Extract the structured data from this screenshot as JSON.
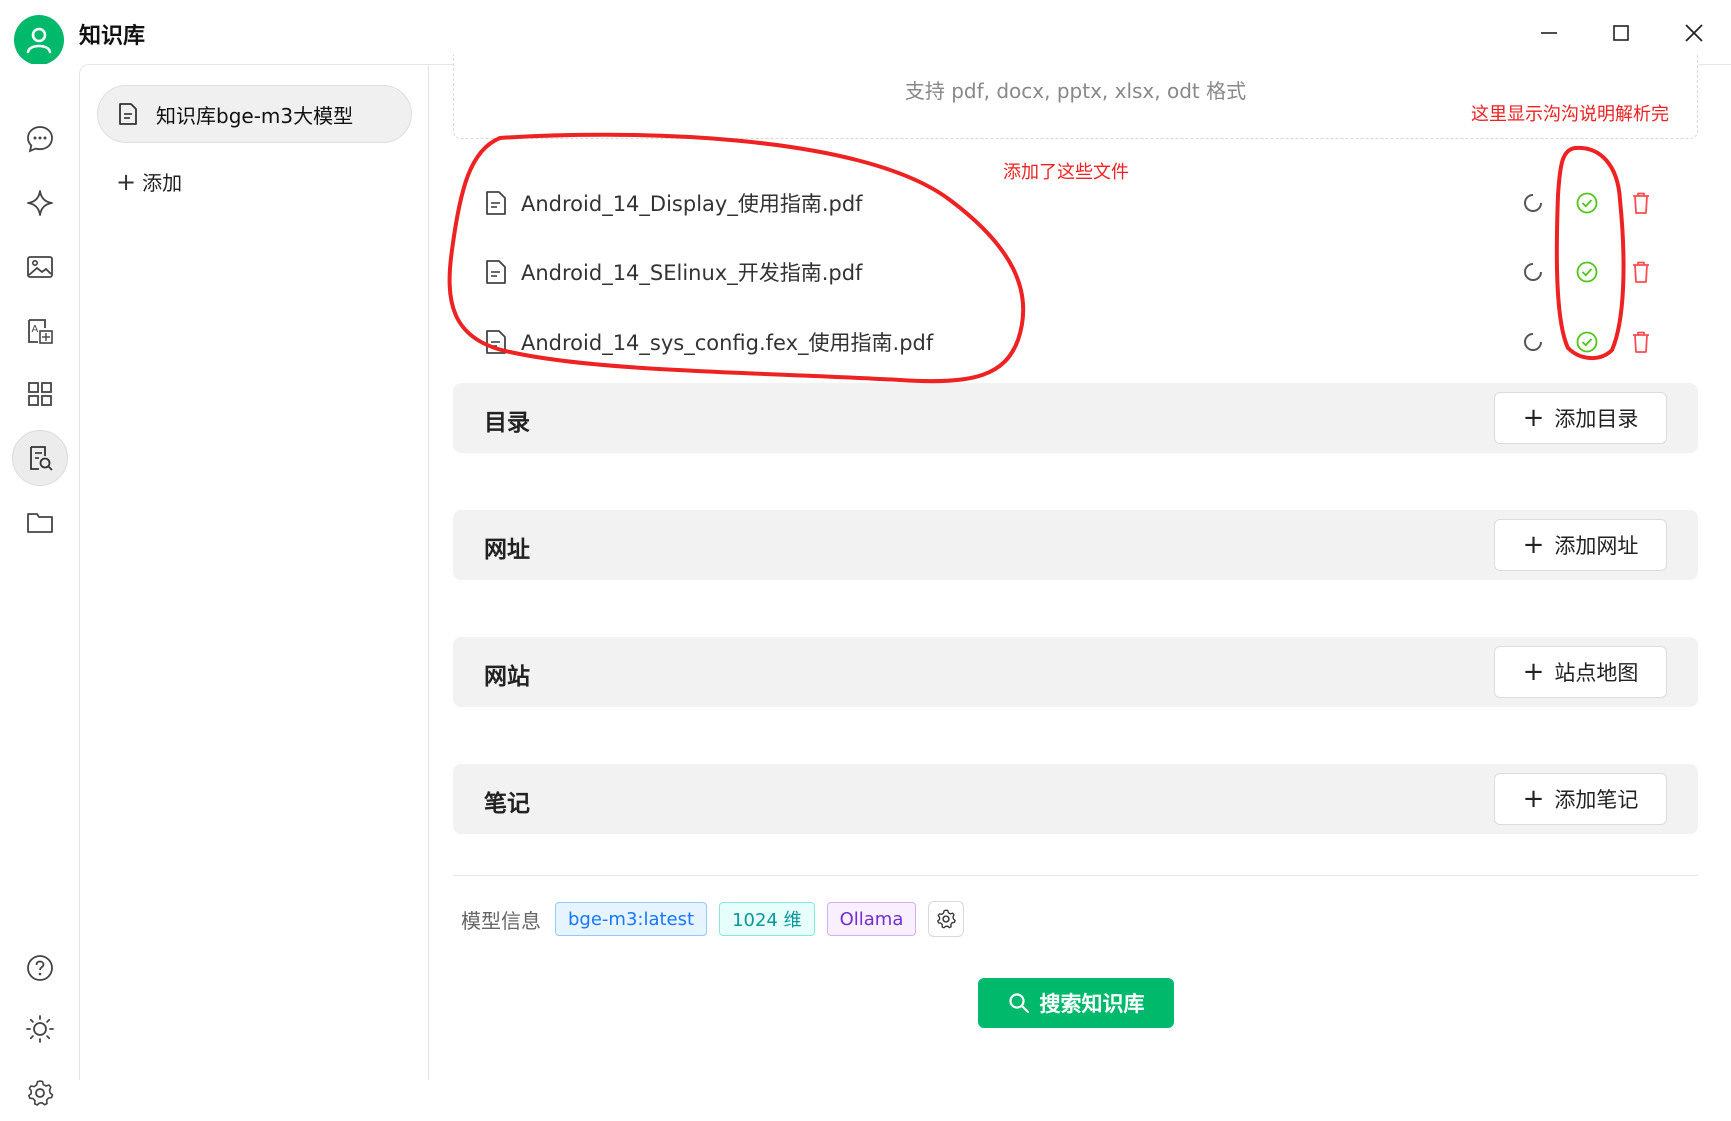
{
  "app": {
    "title": "知识库"
  },
  "rail": {
    "icons": [
      "chat-icon",
      "sparkle-icon",
      "image-icon",
      "translate-icon",
      "apps-grid-icon",
      "knowledge-search-icon",
      "folder-icon",
      "help-icon",
      "sun-icon",
      "settings-icon"
    ],
    "active": "knowledge-search-icon"
  },
  "kb_panel": {
    "items": [
      {
        "label": "知识库bge-m3大模型"
      }
    ],
    "add_label": "添加"
  },
  "upload": {
    "hint": "支持 pdf, docx, pptx, xlsx, odt 格式"
  },
  "files": [
    {
      "name": "Android_14_Display_使用指南.pdf"
    },
    {
      "name": "Android_14_SElinux_开发指南.pdf"
    },
    {
      "name": "Android_14_sys_config.fex_使用指南.pdf"
    }
  ],
  "sections": {
    "directory": {
      "title": "目录",
      "button": "添加目录"
    },
    "url": {
      "title": "网址",
      "button": "添加网址"
    },
    "site": {
      "title": "网站",
      "button": "站点地图"
    },
    "notes": {
      "title": "笔记",
      "button": "添加笔记"
    }
  },
  "model_info": {
    "label": "模型信息",
    "model": "bge-m3:latest",
    "dimensions": "1024 维",
    "provider": "Ollama"
  },
  "search_button": "搜索知识库",
  "annotations": {
    "top_right": "这里显示沟沟说明解析完",
    "files_added": "添加了这些文件"
  },
  "colors": {
    "accent": "#00b96b",
    "annotation": "#ee2222",
    "success": "#52c41a",
    "danger": "#ff4d4f"
  }
}
